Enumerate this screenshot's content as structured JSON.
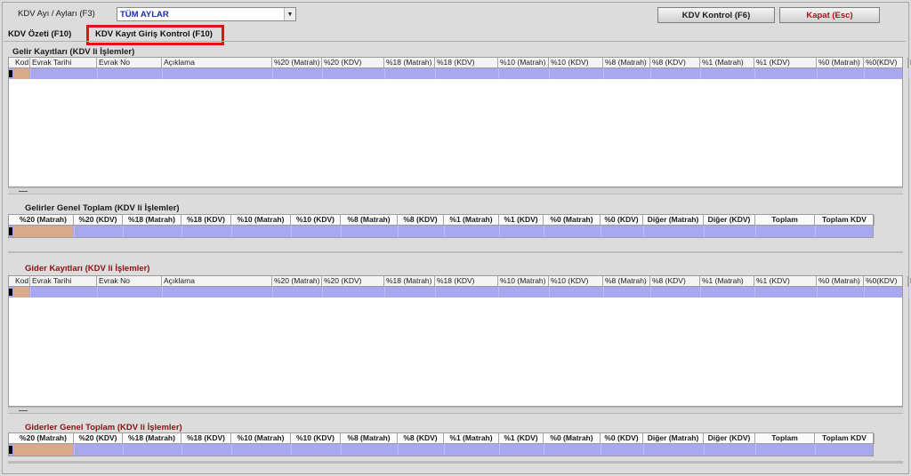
{
  "header": {
    "period_label": "KDV Ayı / Ayları (F3)",
    "period_value": "TÜM AYLAR",
    "kontrol_button": "KDV Kontrol (F6)",
    "kapat_button": "Kapat (Esc)"
  },
  "tabs": [
    {
      "label": "KDV Özeti (F10)"
    },
    {
      "label": "KDV Kayıt Giriş Kontrol  (F10)"
    }
  ],
  "gelir": {
    "title": "Gelir Kayıtları (KDV li İşlemler)",
    "columns": [
      "Kod",
      "Evrak Tarihi",
      "Evrak No",
      "Açıklama",
      "%20 (Matrah)",
      "%20 (KDV)",
      "%18 (Matrah)",
      "%18 (KDV)",
      "%10 (Matrah)",
      "%10 (KDV)",
      "%8 (Matrah)",
      "%8 (KDV)",
      "%1 (Matrah)",
      "%1 (KDV)",
      "%0 (Matrah)",
      "%0(KDV)",
      "D"
    ]
  },
  "gelir_total": {
    "title": "Gelirler Genel Toplam (KDV li İşlemler)",
    "columns": [
      "%20 (Matrah)",
      "%20 (KDV)",
      "%18 (Matrah)",
      "%18 (KDV)",
      "%10 (Matrah)",
      "%10 (KDV)",
      "%8 (Matrah)",
      "%8 (KDV)",
      "%1 (Matrah)",
      "%1 (KDV)",
      "%0 (Matrah)",
      "%0 (KDV)",
      "Diğer (Matrah)",
      "Diğer (KDV)",
      "Toplam",
      "Toplam KDV"
    ]
  },
  "gider": {
    "title": "Gider Kayıtları (KDV li İşlemler)",
    "columns": [
      "Kod",
      "Evrak Tarihi",
      "Evrak No",
      "Açıklama",
      "%20 (Matrah)",
      "%20 (KDV)",
      "%18 (Matrah)",
      "%18 (KDV)",
      "%10 (Matrah)",
      "%10 (KDV)",
      "%8 (Matrah)",
      "%8 (KDV)",
      "%1 (Matrah)",
      "%1 (KDV)",
      "%0 (Matrah)",
      "%0(KDV)",
      "D"
    ]
  },
  "gider_total": {
    "title": "Giderler Genel Toplam (KDV li İşlemler)",
    "columns": [
      "%20 (Matrah)",
      "%20 (KDV)",
      "%18 (Matrah)",
      "%18 (KDV)",
      "%10 (Matrah)",
      "%10 (KDV)",
      "%8 (Matrah)",
      "%8 (KDV)",
      "%1 (Matrah)",
      "%1 (KDV)",
      "%0 (Matrah)",
      "%0 (KDV)",
      "Diğer (Matrah)",
      "Diğer (KDV)",
      "Toplam",
      "Toplam KDV"
    ]
  }
}
